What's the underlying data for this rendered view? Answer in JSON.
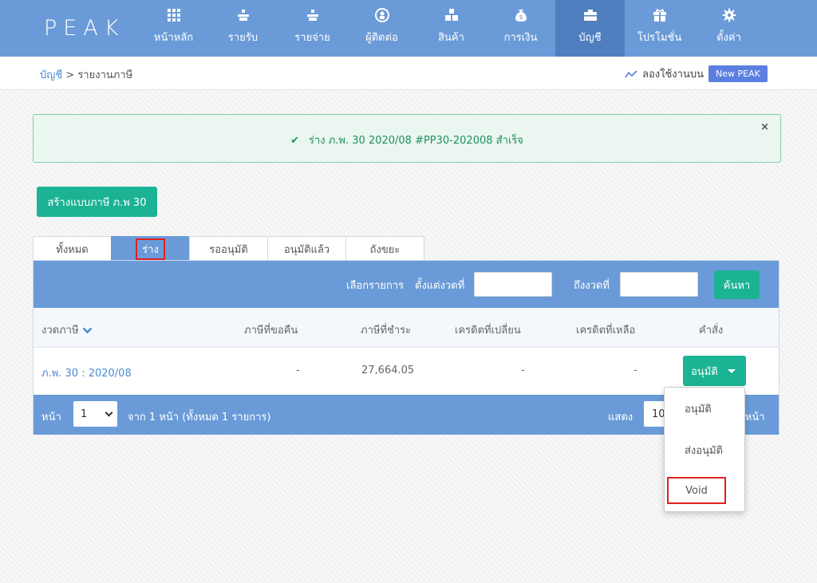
{
  "brand": {
    "logo": "PEAK"
  },
  "nav": [
    {
      "label": "หน้าหลัก",
      "icon": "grid-icon"
    },
    {
      "label": "รายรับ",
      "icon": "income-icon"
    },
    {
      "label": "รายจ่าย",
      "icon": "expense-icon"
    },
    {
      "label": "ผู้ติดต่อ",
      "icon": "contact-icon"
    },
    {
      "label": "สินค้า",
      "icon": "product-boxes-icon"
    },
    {
      "label": "การเงิน",
      "icon": "money-bag-icon"
    },
    {
      "label": "บัญชี",
      "icon": "briefcase-icon",
      "active": true
    },
    {
      "label": "โปรโมชั่น",
      "icon": "gift-icon"
    },
    {
      "label": "ตั้งค่า",
      "icon": "gear-icon"
    }
  ],
  "breadcrumb": {
    "parent": "บัญชี",
    "separator": " > ",
    "current": "รายงานภาษี"
  },
  "try_new": {
    "label": "ลองใช้งานบน",
    "badge": "New PEAK"
  },
  "alert": {
    "message": "ร่าง ภ.พ. 30 2020/08 #PP30-202008 สำเร็จ",
    "close": "×"
  },
  "create_button": "สร้างแบบภาษี ภ.พ 30",
  "tabs": [
    {
      "label": "ทั้งหมด"
    },
    {
      "label": "ร่าง",
      "active": true
    },
    {
      "label": "รออนุมัติ"
    },
    {
      "label": "อนุมัติแล้ว"
    },
    {
      "label": "ถังขยะ"
    }
  ],
  "filter": {
    "select_label": "เลือกรายการ",
    "from_label": "ตั้งแต่งวดที่",
    "to_label": "ถึงงวดที่",
    "from_value": "",
    "to_value": "",
    "search_button": "ค้นหา"
  },
  "table": {
    "headers": [
      "งวดภาษี",
      "ภาษีที่ขอคืน",
      "ภาษีที่ชำระ",
      "เครดิตที่เปลี่ยน",
      "เครดิตที่เหลือ",
      "คำสั่ง"
    ],
    "rows": [
      {
        "period": "ภ.พ. 30 : 2020/08",
        "refund": "-",
        "payable": "27,664.05",
        "credit_changed": "-",
        "credit_remaining": "-",
        "action": "อนุมัติ"
      }
    ]
  },
  "footer": {
    "page_label": "หน้า",
    "page_value": "1",
    "page_info": "จาก 1 หน้า (ทั้งหมด 1 รายการ)",
    "show_label": "แสดง",
    "show_value": "10",
    "per_page_suffix": "อหน้า"
  },
  "dropdown": [
    "อนุมัติ",
    "ส่งอนุมัติ",
    "Void"
  ],
  "colors": {
    "nav": "#6a9bd8",
    "nav_active": "#4f7fbf",
    "accent": "#1bb394",
    "highlight": "#e02020",
    "success_text": "#1f8f62"
  }
}
